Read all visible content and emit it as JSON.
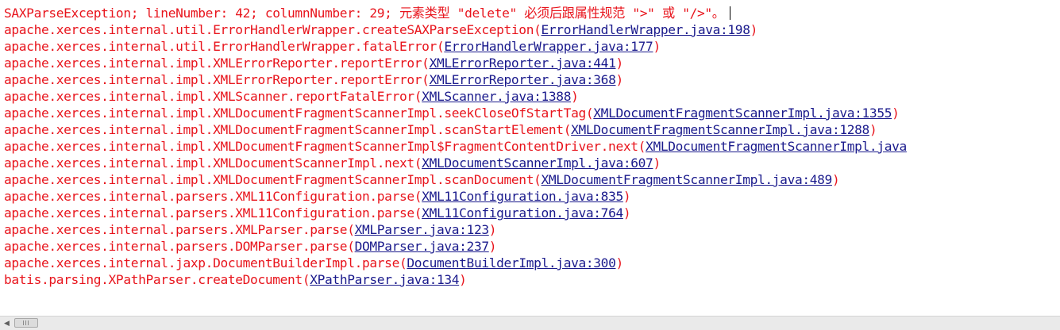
{
  "console": {
    "header": {
      "text": "SAXParseException; lineNumber: 42; columnNumber: 29; 元素类型 \"delete\" 必须后跟属性规范 \">\" 或 \"/>\"。"
    },
    "frames": [
      {
        "method": "apache.xerces.internal.util.ErrorHandlerWrapper.createSAXParseException",
        "source": "ErrorHandlerWrapper.java:198"
      },
      {
        "method": "apache.xerces.internal.util.ErrorHandlerWrapper.fatalError",
        "source": "ErrorHandlerWrapper.java:177"
      },
      {
        "method": "apache.xerces.internal.impl.XMLErrorReporter.reportError",
        "source": "XMLErrorReporter.java:441"
      },
      {
        "method": "apache.xerces.internal.impl.XMLErrorReporter.reportError",
        "source": "XMLErrorReporter.java:368"
      },
      {
        "method": "apache.xerces.internal.impl.XMLScanner.reportFatalError",
        "source": "XMLScanner.java:1388"
      },
      {
        "method": "apache.xerces.internal.impl.XMLDocumentFragmentScannerImpl.seekCloseOfStartTag",
        "source": "XMLDocumentFragmentScannerImpl.java:1355"
      },
      {
        "method": "apache.xerces.internal.impl.XMLDocumentFragmentScannerImpl.scanStartElement",
        "source": "XMLDocumentFragmentScannerImpl.java:1288"
      },
      {
        "method": "apache.xerces.internal.impl.XMLDocumentFragmentScannerImpl$FragmentContentDriver.next",
        "source": "XMLDocumentFragmentScannerImpl.java"
      },
      {
        "method": "apache.xerces.internal.impl.XMLDocumentScannerImpl.next",
        "source": "XMLDocumentScannerImpl.java:607"
      },
      {
        "method": "apache.xerces.internal.impl.XMLDocumentFragmentScannerImpl.scanDocument",
        "source": "XMLDocumentFragmentScannerImpl.java:489"
      },
      {
        "method": "apache.xerces.internal.parsers.XML11Configuration.parse",
        "source": "XML11Configuration.java:835"
      },
      {
        "method": "apache.xerces.internal.parsers.XML11Configuration.parse",
        "source": "XML11Configuration.java:764"
      },
      {
        "method": "apache.xerces.internal.parsers.XMLParser.parse",
        "source": "XMLParser.java:123"
      },
      {
        "method": "apache.xerces.internal.parsers.DOMParser.parse",
        "source": "DOMParser.java:237"
      },
      {
        "method": "apache.xerces.internal.jaxp.DocumentBuilderImpl.parse",
        "source": "DocumentBuilderImpl.java:300"
      },
      {
        "method": "batis.parsing.XPathParser.createDocument",
        "source": "XPathParser.java:134"
      }
    ]
  },
  "colors": {
    "text": "#e8141c",
    "link": "#1a1a8c",
    "background": "#ffffff"
  },
  "icons": {
    "scroll_left": "triangle-left-icon",
    "thumb_grip": "grip-icon"
  }
}
